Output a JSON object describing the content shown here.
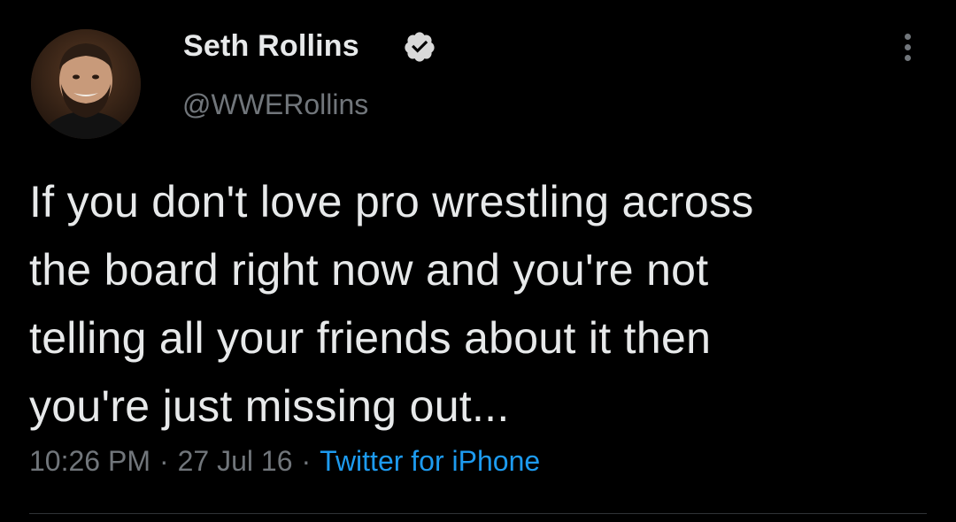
{
  "author": {
    "display_name": "Seth Rollins",
    "handle": "@WWERollins",
    "verified": true,
    "avatar_icon": "profile-photo"
  },
  "tweet": {
    "text": "If you don't love pro wrestling across\nthe board right now and you're not\ntelling all your friends about it then\nyou're just missing out..."
  },
  "meta": {
    "time": "10:26 PM",
    "separator": "·",
    "date": "27 Jul 16",
    "source": "Twitter for iPhone"
  },
  "colors": {
    "background": "#000000",
    "primary_text": "#e7e9ea",
    "secondary_text": "#71767b",
    "link": "#1d9bf0",
    "verified_badge": "#d9d9d9"
  },
  "icons": {
    "verified": "verified-badge-icon",
    "more": "more-options-icon"
  }
}
